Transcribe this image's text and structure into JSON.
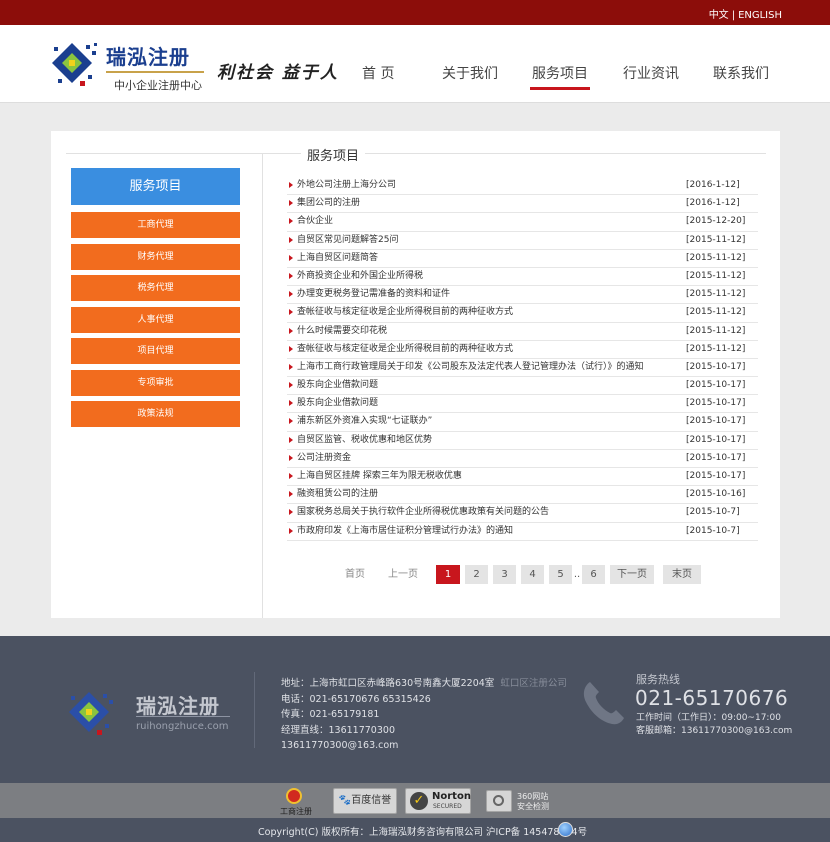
{
  "lang": {
    "zh": "中文",
    "en": "ENGLISH",
    "sep": "|"
  },
  "logo": {
    "name": "瑞泓注册",
    "tagline": "中小企业注册中心"
  },
  "slogan": "利社会 益于人",
  "nav": {
    "items": [
      {
        "label": "首 页"
      },
      {
        "label": "关于我们"
      },
      {
        "label": "服务项目",
        "active": true
      },
      {
        "label": "行业资讯"
      },
      {
        "label": "联系我们"
      }
    ]
  },
  "section_title": "服务项目",
  "sidebar": {
    "header": "服务项目",
    "items": [
      {
        "label": "工商代理"
      },
      {
        "label": "财务代理"
      },
      {
        "label": "税务代理"
      },
      {
        "label": "人事代理"
      },
      {
        "label": "项目代理"
      },
      {
        "label": "专项审批"
      },
      {
        "label": "政策法规"
      }
    ]
  },
  "news": [
    {
      "title": "外地公司注册上海分公司",
      "date": "[2016-1-12]"
    },
    {
      "title": "集团公司的注册",
      "date": "[2016-1-12]"
    },
    {
      "title": "合伙企业",
      "date": "[2015-12-20]"
    },
    {
      "title": "自贸区常见问题解答25问",
      "date": "[2015-11-12]"
    },
    {
      "title": "上海自贸区问题简答",
      "date": "[2015-11-12]"
    },
    {
      "title": "外商投资企业和外国企业所得税",
      "date": "[2015-11-12]"
    },
    {
      "title": "办理变更税务登记需准备的资料和证件",
      "date": "[2015-11-12]"
    },
    {
      "title": "查帐征收与核定征收是企业所得税目前的两种征收方式",
      "date": "[2015-11-12]"
    },
    {
      "title": "什么时候需要交印花税",
      "date": "[2015-11-12]"
    },
    {
      "title": "查帐征收与核定征收是企业所得税目前的两种征收方式",
      "date": "[2015-11-12]"
    },
    {
      "title": "上海市工商行政管理局关于印发《公司股东及法定代表人登记管理办法（试行）》的通知",
      "date": "[2015-10-17]"
    },
    {
      "title": "股东向企业借款问题",
      "date": "[2015-10-17]"
    },
    {
      "title": "股东向企业借款问题",
      "date": "[2015-10-17]"
    },
    {
      "title": "浦东新区外资准入实现“七证联办”",
      "date": "[2015-10-17]"
    },
    {
      "title": "自贸区监管、税收优惠和地区优势",
      "date": "[2015-10-17]"
    },
    {
      "title": "公司注册资金",
      "date": "[2015-10-17]"
    },
    {
      "title": "上海自贸区挂牌 探索三年为限无税收优惠",
      "date": "[2015-10-17]"
    },
    {
      "title": "融资租赁公司的注册",
      "date": "[2015-10-16]"
    },
    {
      "title": "国家税务总局关于执行软件企业所得税优惠政策有关问题的公告",
      "date": "[2015-10-7]"
    },
    {
      "title": "市政府印发《上海市居住证积分管理试行办法》的通知",
      "date": "[2015-10-7]"
    }
  ],
  "pager": {
    "first": "首页",
    "prev": "上一页",
    "pages": [
      "1",
      "2",
      "3",
      "4",
      "5"
    ],
    "ellipsis": "..",
    "last_page": "6",
    "next": "下一页",
    "end": "末页",
    "current": "1"
  },
  "footer": {
    "logo_name": "瑞泓注册",
    "logo_url": "ruihongzhuce.com",
    "address": "地址：上海市虹口区赤峰路630号南鑫大厦2204室",
    "address_note": "虹口区注册公司",
    "phone": "电话：021-65170676 65315426",
    "fax": "传真：021-65179181",
    "manager": "经理直线：13611770300",
    "email": "13611770300@163.com",
    "hotline_label": "服务热线",
    "hotline_number": "021-65170676",
    "hours": "工作时间（工作日）：09:00~17:00",
    "service_email": "客服邮箱：13611770300@163.com"
  },
  "badges": {
    "gongshang": "工商注册",
    "baidu": "百度信誉",
    "norton_main": "Norton",
    "norton_sub": "SECURED",
    "check_line1": "360网站",
    "check_line2": "安全检测"
  },
  "copyright": "Copyright(C) 版权所有：上海瑞泓财务咨询有限公司 沪ICP备 145478854号"
}
